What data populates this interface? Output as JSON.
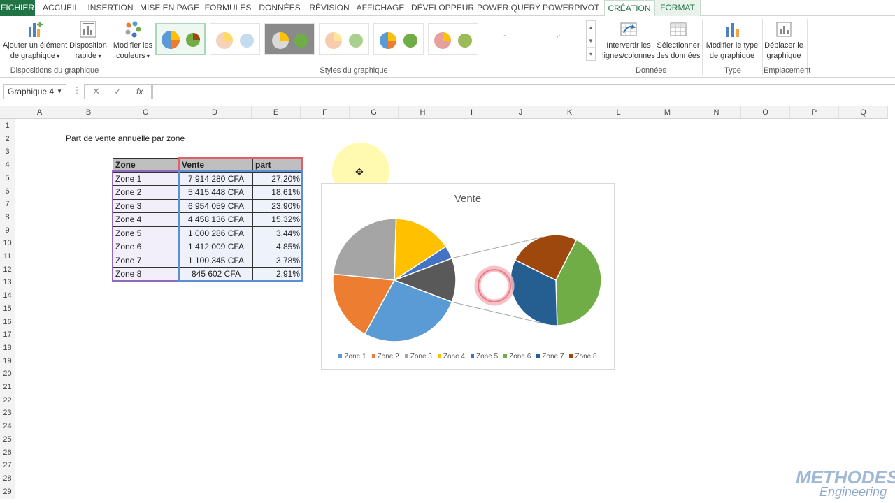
{
  "ribbon_tabs": [
    "FICHIER",
    "ACCUEIL",
    "INSERTION",
    "MISE EN PAGE",
    "FORMULES",
    "DONNÉES",
    "RÉVISION",
    "AFFICHAGE",
    "DÉVELOPPEUR",
    "POWER QUERY",
    "POWERPIVOT",
    "CRÉATION",
    "FORMAT"
  ],
  "ribbon": {
    "add_element": "Ajouter un élément de graphique",
    "quick_layout": "Disposition rapide",
    "change_colors": "Modifier les couleurs",
    "switch_rows": "Intervertir les lignes/colonnes",
    "select_data": "Sélectionner des données",
    "change_type": "Modifier le type de graphique",
    "move_chart": "Déplacer le graphique",
    "group_layouts": "Dispositions du graphique",
    "group_styles": "Styles du graphique",
    "group_data": "Données",
    "group_type": "Type",
    "group_location": "Emplacement"
  },
  "formula_bar": {
    "name_box": "Graphique 4",
    "fx": "fx",
    "cancel": "✕",
    "enter": "✓",
    "value": ""
  },
  "columns": [
    "A",
    "B",
    "C",
    "D",
    "E",
    "F",
    "G",
    "H",
    "I",
    "J",
    "K",
    "L",
    "M",
    "N",
    "O",
    "P",
    "Q"
  ],
  "rows": [
    "1",
    "2",
    "3",
    "4",
    "5",
    "6",
    "7",
    "8",
    "9",
    "10",
    "11",
    "12",
    "13",
    "14",
    "15",
    "16",
    "17",
    "18",
    "19",
    "20",
    "21",
    "22",
    "23",
    "24",
    "25",
    "26",
    "27",
    "28",
    "29"
  ],
  "sheet_title": "Part de vente annuelle par zone",
  "table": {
    "headers": [
      "Zone",
      "Vente",
      "part"
    ],
    "rows": [
      [
        "Zone 1",
        "7 914 280 CFA",
        "27,20%"
      ],
      [
        "Zone 2",
        "5 415 448 CFA",
        "18,61%"
      ],
      [
        "Zone 3",
        "6 954 059 CFA",
        "23,90%"
      ],
      [
        "Zone 4",
        "4 458 136 CFA",
        "15,32%"
      ],
      [
        "Zone 5",
        "1 000 286 CFA",
        "3,44%"
      ],
      [
        "Zone 6",
        "1 412 009 CFA",
        "4,85%"
      ],
      [
        "Zone 7",
        "1 100 345 CFA",
        "3,78%"
      ],
      [
        "Zone 8",
        "845 602 CFA",
        "2,91%"
      ]
    ]
  },
  "chart_data": {
    "type": "pie",
    "subtype": "pie-of-pie",
    "title": "Vente",
    "categories": [
      "Zone 1",
      "Zone 2",
      "Zone 3",
      "Zone 4",
      "Zone 5",
      "Zone 6",
      "Zone 7",
      "Zone 8"
    ],
    "values": [
      7914280,
      5415448,
      6954059,
      4458136,
      1000286,
      1412009,
      1100345,
      845602
    ],
    "secondary_categories": [
      "Zone 6",
      "Zone 7",
      "Zone 8"
    ],
    "colors": [
      "#5b9bd5",
      "#ed7d31",
      "#a5a5a5",
      "#ffc000",
      "#4472c4",
      "#70ad47",
      "#255e91",
      "#9e480e"
    ],
    "legend_position": "bottom"
  },
  "logo": {
    "line1": "METHODES",
    "line2": "Engineering"
  }
}
